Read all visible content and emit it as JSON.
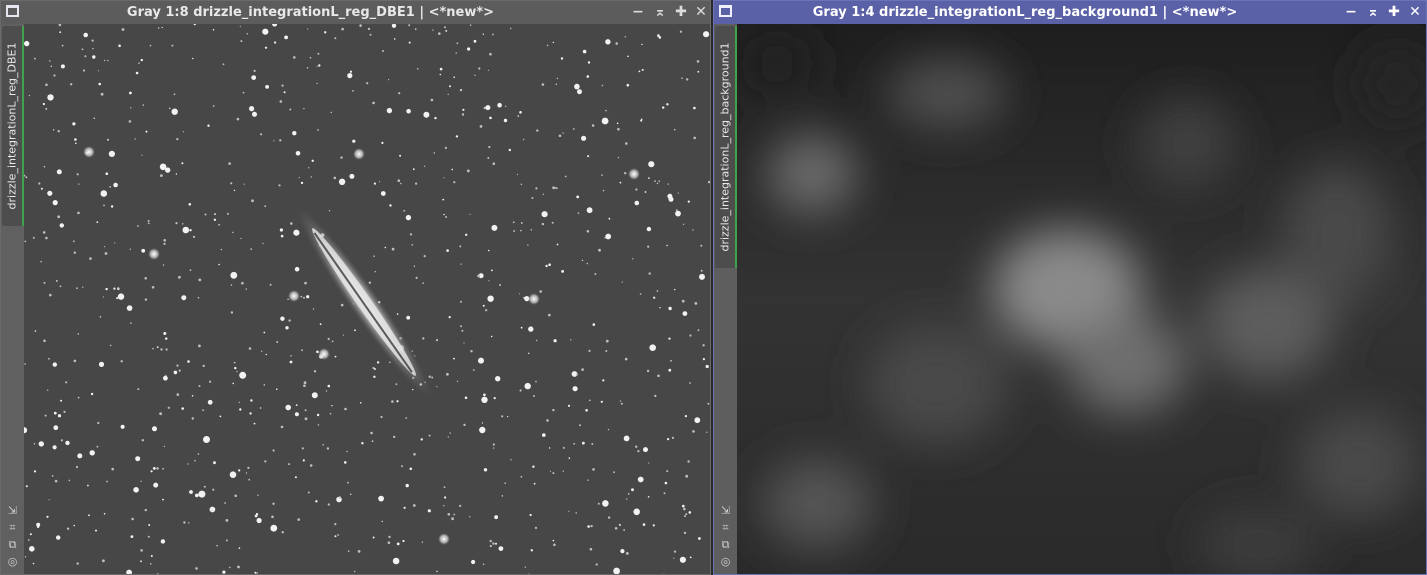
{
  "windows": [
    {
      "title": "Gray 1:8 drizzle_integrationL_reg_DBE1 | <*new*>",
      "tab_label": "drizzle_integrationL_reg_DBE1",
      "active": false,
      "buttons": {
        "minimize": "−",
        "shade": "⌅",
        "maximize": "✚",
        "close": "✕"
      }
    },
    {
      "title": "Gray 1:4 drizzle_integrationL_reg_background1 | <*new*>",
      "tab_label": "drizzle_integrationL_reg_background1",
      "active": true,
      "buttons": {
        "minimize": "−",
        "shade": "⌅",
        "maximize": "✚",
        "close": "✕"
      }
    }
  ],
  "side_icons": [
    "resize-icon",
    "fit-icon",
    "clone-icon",
    "identity-icon"
  ],
  "colors": {
    "active_title": "#5a61a6",
    "inactive_title": "#5c5c5c",
    "tab_accent": "#3fa34d"
  }
}
